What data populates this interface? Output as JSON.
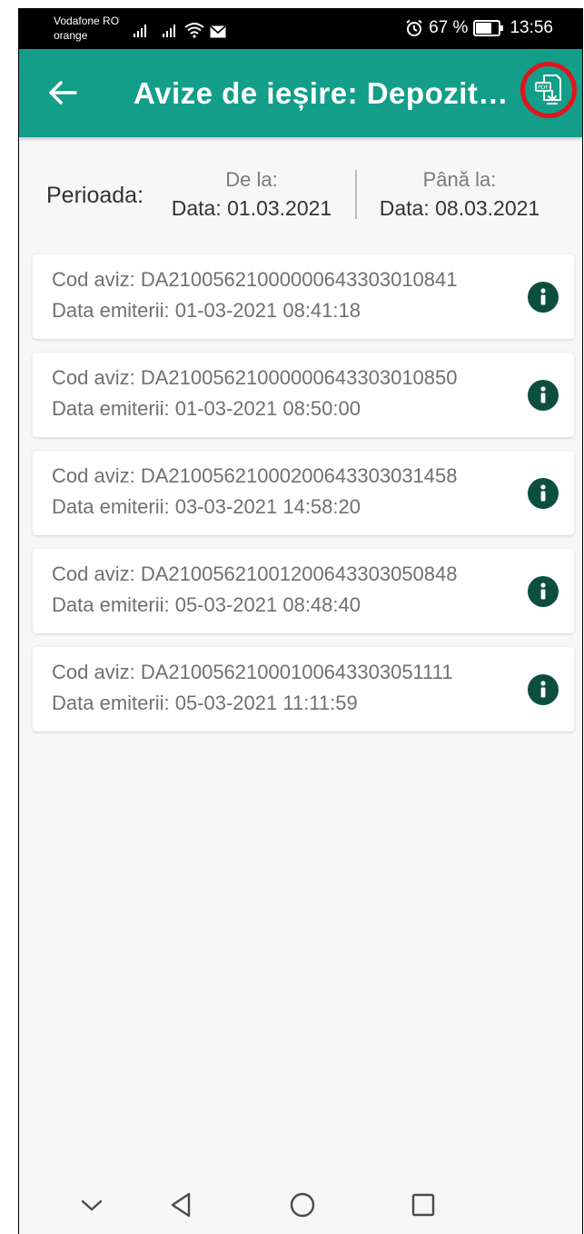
{
  "status_bar": {
    "carrier_line1": "Vodafone RO",
    "carrier_line2": "orange",
    "battery_percent": "67 %",
    "time": "13:56",
    "icons": [
      "signal-icon",
      "signal-icon",
      "wifi-icon",
      "mail-icon",
      "alarm-icon",
      "battery-icon"
    ]
  },
  "app_bar": {
    "title": "Avize de ieșire: Depozit…",
    "back_icon": "arrow-back-icon",
    "action_icon": "pdf-download-icon",
    "color": "#139e89",
    "highlight_color": "#e2141c"
  },
  "period": {
    "label": "Perioada:",
    "from_label": "De la:",
    "from_value": "Data: 01.03.2021",
    "to_label": "Până la:",
    "to_value": "Data: 08.03.2021"
  },
  "avize": [
    {
      "cod": "Cod aviz: DA21005621000000643303010841",
      "data": "Data emiterii: 01-03-2021 08:41:18"
    },
    {
      "cod": "Cod aviz: DA21005621000000643303010850",
      "data": "Data emiterii: 01-03-2021 08:50:00"
    },
    {
      "cod": "Cod aviz: DA21005621000200643303031458",
      "data": "Data emiterii: 03-03-2021 14:58:20"
    },
    {
      "cod": "Cod aviz: DA21005621001200643303050848",
      "data": "Data emiterii: 05-03-2021 08:48:40"
    },
    {
      "cod": "Cod aviz: DA21005621000100643303051111",
      "data": "Data emiterii: 05-03-2021 11:11:59"
    }
  ],
  "info_icon": "info-icon",
  "info_color": "#0c4f3f",
  "nav_bar": {
    "icons": [
      "chevron-down-icon",
      "back-triangle-icon",
      "home-circle-icon",
      "recents-square-icon"
    ]
  }
}
